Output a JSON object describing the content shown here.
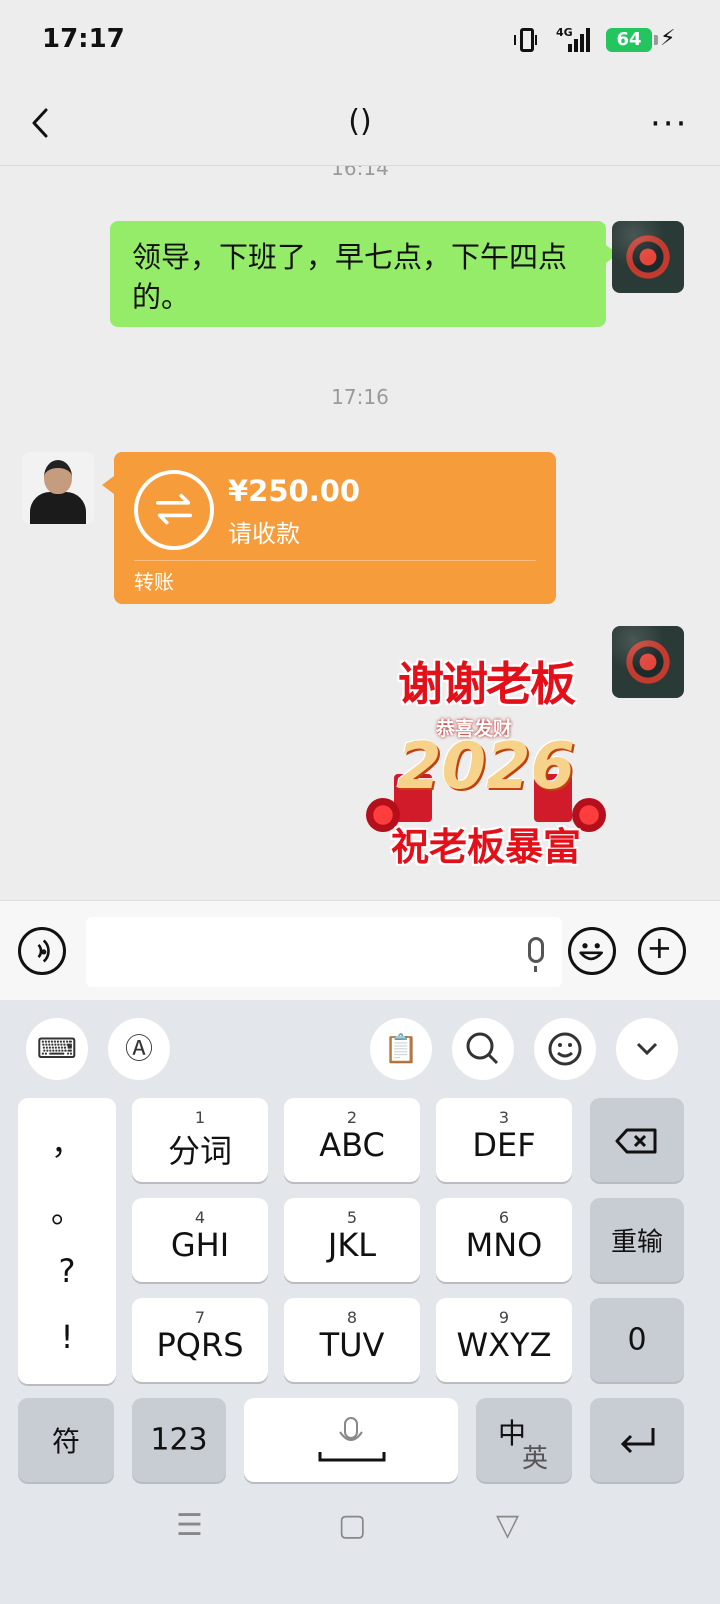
{
  "status": {
    "time": "17:17",
    "network": "4G",
    "battery": "64"
  },
  "header": {
    "title": "()"
  },
  "chat": {
    "timestamp_top": "16:14",
    "message_text": "领导，下班了，早七点，下午四点的。",
    "timestamp_mid": "17:16",
    "transfer": {
      "amount": "¥250.00",
      "note": "请收款",
      "label": "转账"
    },
    "sticker": {
      "line1": "谢谢老板",
      "line2": "恭喜发财",
      "line3": "2026",
      "line4": "祝老板暴富"
    }
  },
  "keyboard": {
    "punctuation": [
      "，",
      "。",
      "?",
      "!"
    ],
    "keys": [
      {
        "num": "1",
        "label": "分词"
      },
      {
        "num": "2",
        "label": "ABC"
      },
      {
        "num": "3",
        "label": "DEF"
      },
      {
        "num": "4",
        "label": "GHI"
      },
      {
        "num": "5",
        "label": "JKL"
      },
      {
        "num": "6",
        "label": "MNO"
      },
      {
        "num": "7",
        "label": "PQRS"
      },
      {
        "num": "8",
        "label": "TUV"
      },
      {
        "num": "9",
        "label": "WXYZ"
      }
    ],
    "reinput": "重输",
    "zero": "0",
    "symbols": "符",
    "numbers": "123",
    "lang_primary": "中",
    "lang_secondary": "英"
  }
}
